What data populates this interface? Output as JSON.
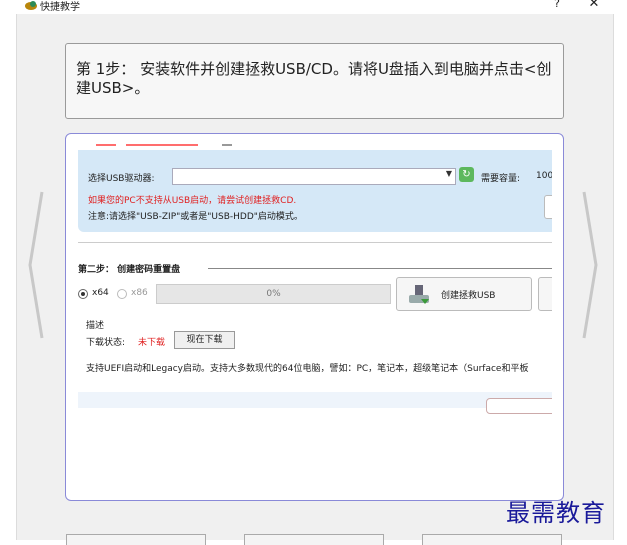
{
  "window": {
    "title": "快捷教学",
    "help": "?",
    "close": "✕"
  },
  "step": {
    "text": "第 1步： 安装软件并创建拯救USB/CD。请将U盘插入到电脑并点击<创建USB>。"
  },
  "preview": {
    "usb_label": "选择USB驱动器:",
    "capacity_label": "需要容量:",
    "capacity_value": "100",
    "warning": "如果您的PC不支持从USB启动，请尝试创建拯救CD.",
    "note": "注意:请选择\"USB-ZIP\"或者是\"USB-HDD\"启动模式。",
    "step2_title": "第二步： 创建密码重置盘",
    "arch_x64": "x64",
    "arch_x86": "x86",
    "progress_text": "0%",
    "progress": 0,
    "create_usb": "创建拯救USB",
    "desc_label": "描述",
    "download_status_label": "下载状态:",
    "download_status": "未下载",
    "download_now": "现在下载",
    "support_text": "支持UEFI启动和Legacy启动。支持大多数现代的64位电脑，譬如：PC，笔记本，超级笔记本（Surface和平板"
  },
  "watermark": "最需教育",
  "colors": {
    "frame_border": "#8a8ad8",
    "panel_bg": "#d5e8f7",
    "warning": "#e02020",
    "watermark": "#1a1a9a"
  }
}
